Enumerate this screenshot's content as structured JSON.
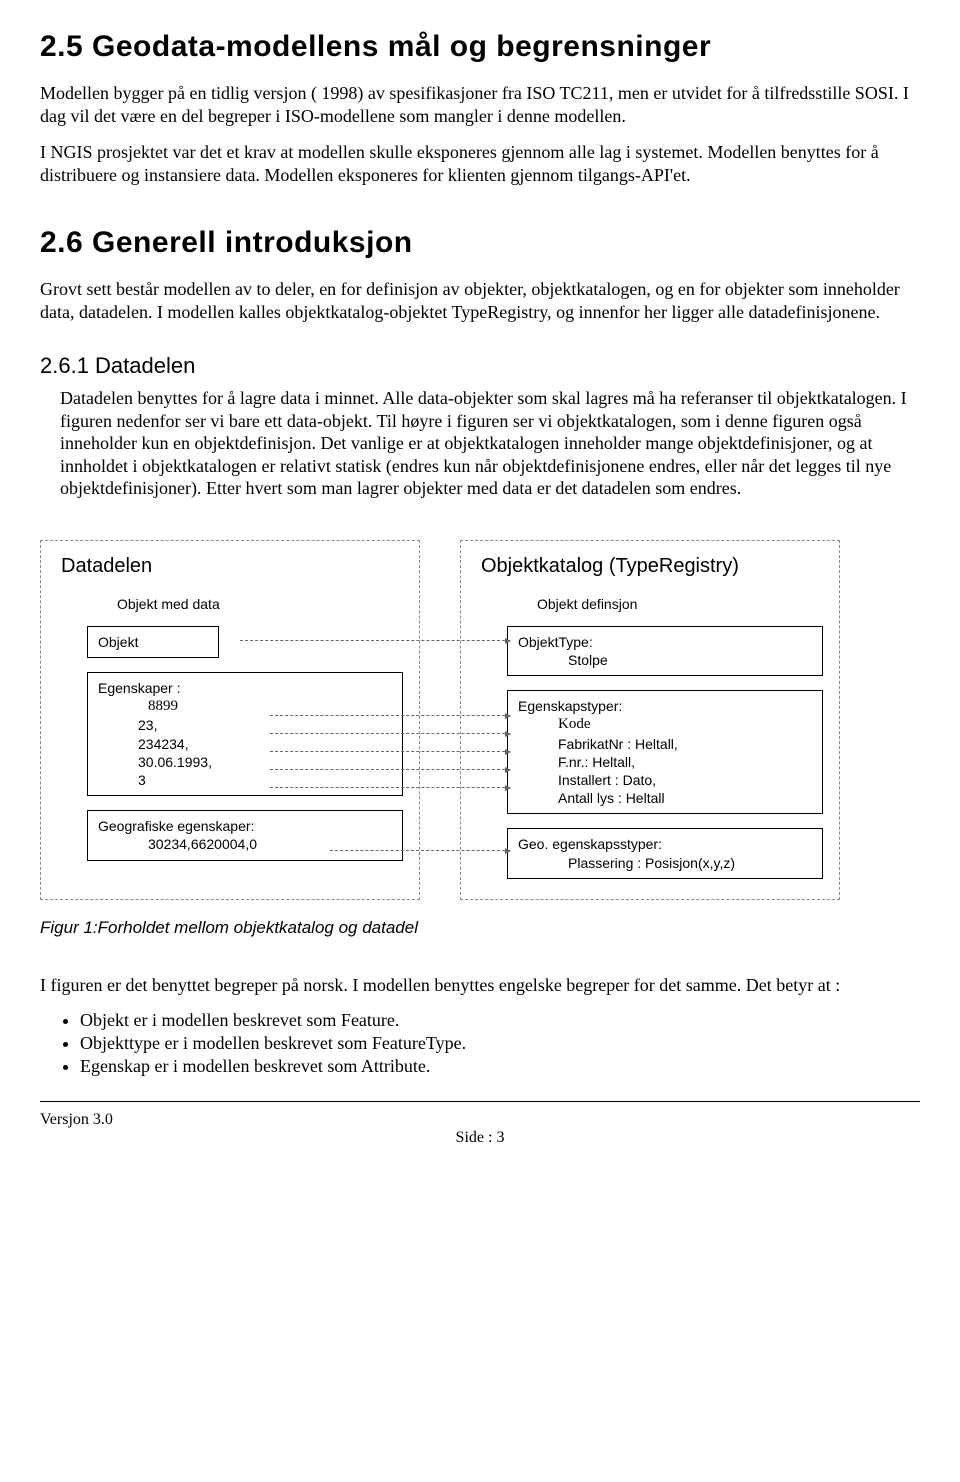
{
  "section25": {
    "heading": "2.5 Geodata-modellens mål og begrensninger",
    "p1": "Modellen bygger på en tidlig versjon ( 1998) av spesifikasjoner fra ISO TC211, men er utvidet for å tilfredsstille SOSI. I dag vil det være en del begreper i ISO-modellene som  mangler i denne modellen.",
    "p2": "I NGIS prosjektet var det et krav at modellen skulle eksponeres gjennom alle lag i systemet. Modellen benyttes for å distribuere og instansiere data. Modellen eksponeres for klienten gjennom tilgangs-API'et."
  },
  "section26": {
    "heading": "2.6 Generell introduksjon",
    "p1": "Grovt sett består modellen av to deler, en for definisjon av objekter, objektkatalogen, og en for objekter som inneholder data, datadelen. I modellen kalles objektkatalog-objektet TypeRegistry, og innenfor her ligger alle datadefinisjonene.",
    "sub261_heading": "2.6.1   Datadelen",
    "sub261_body": "Datadelen benyttes for å lagre data i minnet. Alle data-objekter som skal lagres må ha referanser til objektkatalogen. I figuren nedenfor ser vi bare ett data-objekt. Til høyre i figuren ser vi objektkatalogen, som i denne figuren også inneholder kun en objektdefinisjon. Det vanlige er at objektkatalogen inneholder mange objektdefinisjoner, og at innholdet i objektkatalogen er relativt statisk (endres kun når objektdefinisjonene endres, eller når det legges til nye objektdefinisjoner). Etter hvert som man lagrer objekter med data er det datadelen som endres."
  },
  "diagram": {
    "left": {
      "panel_title": "Datadelen",
      "group_header": "Objekt med data",
      "objekt_label": "Objekt",
      "egenskaper_label": "Egenskaper :",
      "egenskaper_values": [
        "8899",
        "23,",
        "234234,",
        "30.06.1993,",
        "3"
      ],
      "geo_label": "Geografiske egenskaper:",
      "geo_value": "30234,6620004,0"
    },
    "right": {
      "panel_title": "Objektkatalog (TypeRegistry)",
      "group_header": "Objekt definsjon",
      "objekttype_label": "ObjektType:",
      "objekttype_value": "Stolpe",
      "egensktyper_label": "Egenskapstyper:",
      "egensktyper_values": [
        "Kode",
        "FabrikatNr : Heltall,",
        "F.nr.: Heltall,",
        "Installert : Dato,",
        "Antall lys : Heltall"
      ],
      "geotype_label": "Geo. egenskapsstyper:",
      "geotype_value": "Plassering : Posisjon(x,y,z)"
    },
    "caption": "Figur 1:Forholdet mellom objektkatalog og datadel"
  },
  "closing": {
    "p": "I figuren er det benyttet begreper på norsk. I modellen benyttes engelske begreper for det samme. Det betyr at :",
    "bullets": [
      "Objekt er i modellen beskrevet som Feature.",
      "Objekttype er i modellen beskrevet som FeatureType.",
      "Egenskap er i modellen beskrevet som Attribute."
    ]
  },
  "footer": {
    "version": "Versjon 3.0",
    "page": "Side : 3"
  }
}
